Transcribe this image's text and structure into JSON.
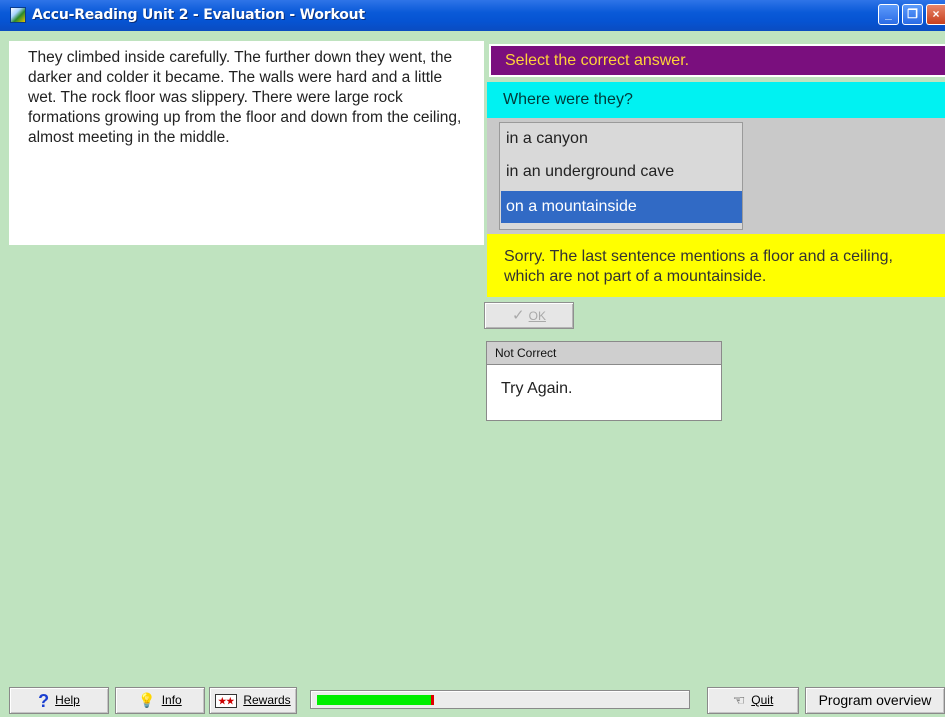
{
  "window": {
    "title": "Accu-Reading Unit 2 - Evaluation - Workout",
    "controls": [
      "minimize",
      "restore",
      "close"
    ]
  },
  "passage": {
    "text": "They climbed inside carefully. The further down they went, the darker and colder it became. The walls were hard and a little wet.  The rock floor was slippery. There were large rock formations growing up from the floor and down from the ceiling, almost meeting in the middle."
  },
  "quiz": {
    "instruction": "Select the correct answer.",
    "question": "Where were they?",
    "choices": [
      {
        "label": "in a canyon",
        "selected": false
      },
      {
        "label": "in an underground cave",
        "selected": false
      },
      {
        "label": "on a mountainside",
        "selected": true
      }
    ],
    "feedback": "Sorry. The last sentence mentions a floor and a ceiling, which are not part of a mountainside.",
    "ok_label": "OK",
    "ok_enabled": false,
    "result_title": "Not Correct",
    "result_message": "Try Again."
  },
  "toolbar": {
    "help_label": "Help",
    "info_label": "Info",
    "rewards_label": "Rewards",
    "quit_label": "Quit",
    "overview_label": "Program overview",
    "progress_fraction": 0.31
  },
  "colors": {
    "background": "#bfe3bf",
    "instruction_bg": "#7a0f7e",
    "instruction_text": "#ffd23a",
    "question_bg": "#00f2f2",
    "feedback_bg": "#ffff00",
    "selected_choice": "#316ac5",
    "progress_fill": "#00ee00",
    "progress_marker": "#e00000"
  },
  "icons": {
    "help": "question-mark-icon",
    "info": "lightbulb-icon",
    "rewards": "film-reward-icon",
    "quit": "exit-hand-icon",
    "ok": "checkmark-icon"
  }
}
